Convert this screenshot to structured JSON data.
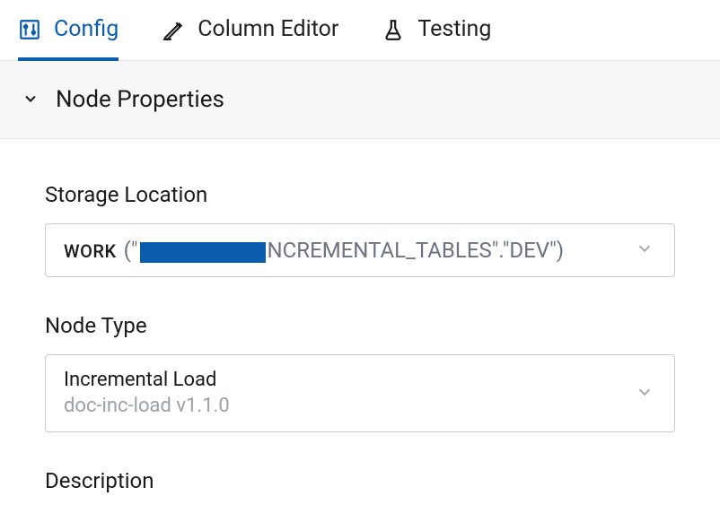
{
  "tabs": {
    "config": "Config",
    "column_editor": "Column Editor",
    "testing": "Testing"
  },
  "section": {
    "title": "Node Properties"
  },
  "fields": {
    "storage": {
      "label": "Storage Location",
      "prefix": "WORK",
      "path_before": "(\"",
      "path_after": "NCREMENTAL_TABLES\".\"DEV\")"
    },
    "node_type": {
      "label": "Node Type",
      "value": "Incremental Load",
      "sub": "doc-inc-load v1.1.0"
    },
    "description": {
      "label": "Description"
    }
  }
}
